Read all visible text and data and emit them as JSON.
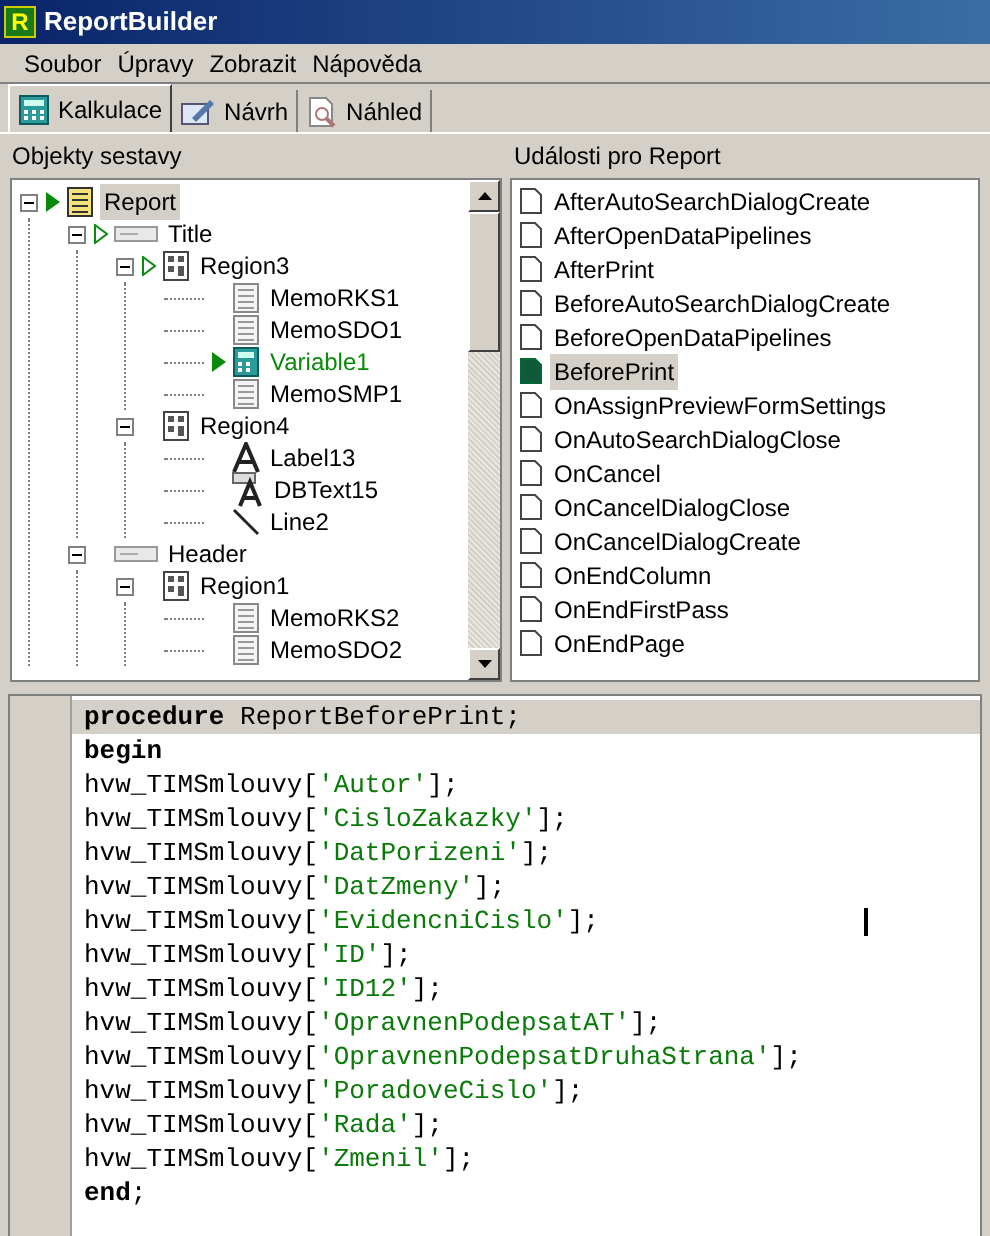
{
  "window": {
    "title": "ReportBuilder",
    "app_icon": "R"
  },
  "menu": [
    "Soubor",
    "Úpravy",
    "Zobrazit",
    "Nápověda"
  ],
  "tabs": [
    {
      "label": "Kalkulace",
      "kind": "calc",
      "selected": true
    },
    {
      "label": "Návrh",
      "kind": "design",
      "selected": false
    },
    {
      "label": "Náhled",
      "kind": "preview",
      "selected": false
    }
  ],
  "objects_panel": {
    "title": "Objekty sestavy",
    "tree": [
      {
        "label": "Report",
        "kind": "report",
        "has_event": true,
        "selected": true,
        "code": false,
        "expanded": true,
        "children": [
          {
            "label": "Title",
            "kind": "band",
            "has_event": false,
            "child_has_event": true,
            "selected": false,
            "code": false,
            "expanded": true,
            "children": [
              {
                "label": "Region3",
                "kind": "region",
                "has_event": false,
                "child_has_event": true,
                "selected": false,
                "code": false,
                "expanded": true,
                "children": [
                  {
                    "label": "MemoRKS1",
                    "kind": "memo",
                    "has_event": false,
                    "selected": false,
                    "code": false
                  },
                  {
                    "label": "MemoSDO1",
                    "kind": "memo",
                    "has_event": false,
                    "selected": false,
                    "code": false
                  },
                  {
                    "label": "Variable1",
                    "kind": "variable",
                    "has_event": true,
                    "selected": false,
                    "code": true
                  },
                  {
                    "label": "MemoSMP1",
                    "kind": "memo",
                    "has_event": false,
                    "selected": false,
                    "code": false
                  }
                ]
              },
              {
                "label": "Region4",
                "kind": "region",
                "has_event": false,
                "child_has_event": false,
                "selected": false,
                "code": false,
                "expanded": true,
                "children": [
                  {
                    "label": "Label13",
                    "kind": "label",
                    "has_event": false,
                    "selected": false,
                    "code": false
                  },
                  {
                    "label": "DBText15",
                    "kind": "dbtext",
                    "has_event": false,
                    "selected": false,
                    "code": false
                  },
                  {
                    "label": "Line2",
                    "kind": "line",
                    "has_event": false,
                    "selected": false,
                    "code": false
                  }
                ]
              }
            ]
          },
          {
            "label": "Header",
            "kind": "band",
            "has_event": false,
            "child_has_event": false,
            "selected": false,
            "code": false,
            "expanded": true,
            "children": [
              {
                "label": "Region1",
                "kind": "region",
                "has_event": false,
                "selected": false,
                "code": false,
                "expanded": true,
                "children": [
                  {
                    "label": "MemoRKS2",
                    "kind": "memo",
                    "has_event": false,
                    "selected": false,
                    "code": false
                  },
                  {
                    "label": "MemoSDO2",
                    "kind": "memo",
                    "has_event": false,
                    "selected": false,
                    "code": false
                  }
                ]
              }
            ]
          }
        ]
      }
    ]
  },
  "events_panel": {
    "title": "Události pro Report",
    "items": [
      {
        "label": "AfterAutoSearchDialogCreate",
        "selected": false,
        "has_code": false
      },
      {
        "label": "AfterOpenDataPipelines",
        "selected": false,
        "has_code": false
      },
      {
        "label": "AfterPrint",
        "selected": false,
        "has_code": false
      },
      {
        "label": "BeforeAutoSearchDialogCreate",
        "selected": false,
        "has_code": false
      },
      {
        "label": "BeforeOpenDataPipelines",
        "selected": false,
        "has_code": false
      },
      {
        "label": "BeforePrint",
        "selected": true,
        "has_code": true
      },
      {
        "label": "OnAssignPreviewFormSettings",
        "selected": false,
        "has_code": false
      },
      {
        "label": "OnAutoSearchDialogClose",
        "selected": false,
        "has_code": false
      },
      {
        "label": "OnCancel",
        "selected": false,
        "has_code": false
      },
      {
        "label": "OnCancelDialogClose",
        "selected": false,
        "has_code": false
      },
      {
        "label": "OnCancelDialogCreate",
        "selected": false,
        "has_code": false
      },
      {
        "label": "OnEndColumn",
        "selected": false,
        "has_code": false
      },
      {
        "label": "OnEndFirstPass",
        "selected": false,
        "has_code": false
      },
      {
        "label": "OnEndPage",
        "selected": false,
        "has_code": false
      }
    ]
  },
  "code_editor": {
    "lines": [
      {
        "current": true,
        "caret": false,
        "segments": [
          {
            "kind": "keyword",
            "text": "procedure"
          },
          {
            "kind": "plain",
            "text": " ReportBeforePrint;"
          }
        ]
      },
      {
        "current": false,
        "caret": false,
        "segments": [
          {
            "kind": "keyword",
            "text": "begin"
          }
        ]
      },
      {
        "current": false,
        "caret": false,
        "segments": [
          {
            "kind": "plain",
            "text": "hvw_TIMSmlouvy["
          },
          {
            "kind": "string",
            "text": "'Autor'"
          },
          {
            "kind": "plain",
            "text": "];"
          }
        ]
      },
      {
        "current": false,
        "caret": false,
        "segments": [
          {
            "kind": "plain",
            "text": "hvw_TIMSmlouvy["
          },
          {
            "kind": "string",
            "text": "'CisloZakazky'"
          },
          {
            "kind": "plain",
            "text": "];"
          }
        ]
      },
      {
        "current": false,
        "caret": false,
        "segments": [
          {
            "kind": "plain",
            "text": "hvw_TIMSmlouvy["
          },
          {
            "kind": "string",
            "text": "'DatPorizeni'"
          },
          {
            "kind": "plain",
            "text": "];"
          }
        ]
      },
      {
        "current": false,
        "caret": false,
        "segments": [
          {
            "kind": "plain",
            "text": "hvw_TIMSmlouvy["
          },
          {
            "kind": "string",
            "text": "'DatZmeny'"
          },
          {
            "kind": "plain",
            "text": "];"
          }
        ]
      },
      {
        "current": false,
        "caret": true,
        "segments": [
          {
            "kind": "plain",
            "text": "hvw_TIMSmlouvy["
          },
          {
            "kind": "string",
            "text": "'EvidencniCislo'"
          },
          {
            "kind": "plain",
            "text": "];"
          }
        ]
      },
      {
        "current": false,
        "caret": false,
        "segments": [
          {
            "kind": "plain",
            "text": "hvw_TIMSmlouvy["
          },
          {
            "kind": "string",
            "text": "'ID'"
          },
          {
            "kind": "plain",
            "text": "];"
          }
        ]
      },
      {
        "current": false,
        "caret": false,
        "segments": [
          {
            "kind": "plain",
            "text": "hvw_TIMSmlouvy["
          },
          {
            "kind": "string",
            "text": "'ID12'"
          },
          {
            "kind": "plain",
            "text": "];"
          }
        ]
      },
      {
        "current": false,
        "caret": false,
        "segments": [
          {
            "kind": "plain",
            "text": "hvw_TIMSmlouvy["
          },
          {
            "kind": "string",
            "text": "'OpravnenPodepsatAT'"
          },
          {
            "kind": "plain",
            "text": "];"
          }
        ]
      },
      {
        "current": false,
        "caret": false,
        "segments": [
          {
            "kind": "plain",
            "text": "hvw_TIMSmlouvy["
          },
          {
            "kind": "string",
            "text": "'OpravnenPodepsatDruhaStrana'"
          },
          {
            "kind": "plain",
            "text": "];"
          }
        ]
      },
      {
        "current": false,
        "caret": false,
        "segments": [
          {
            "kind": "plain",
            "text": "hvw_TIMSmlouvy["
          },
          {
            "kind": "string",
            "text": "'PoradoveCislo'"
          },
          {
            "kind": "plain",
            "text": "];"
          }
        ]
      },
      {
        "current": false,
        "caret": false,
        "segments": [
          {
            "kind": "plain",
            "text": "hvw_TIMSmlouvy["
          },
          {
            "kind": "string",
            "text": "'Rada'"
          },
          {
            "kind": "plain",
            "text": "];"
          }
        ]
      },
      {
        "current": false,
        "caret": false,
        "segments": [
          {
            "kind": "plain",
            "text": "hvw_TIMSmlouvy["
          },
          {
            "kind": "string",
            "text": "'Zmenil'"
          },
          {
            "kind": "plain",
            "text": "];"
          }
        ]
      },
      {
        "current": false,
        "caret": false,
        "segments": [
          {
            "kind": "keyword",
            "text": "end"
          },
          {
            "kind": "plain",
            "text": ";"
          }
        ]
      }
    ]
  }
}
